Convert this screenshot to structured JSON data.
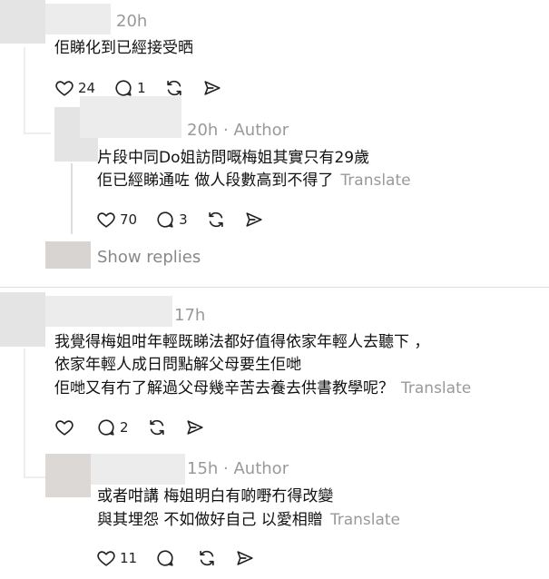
{
  "posts": [
    {
      "time": "20h",
      "author_tag": "",
      "lines": [
        "佢睇化到已經接受晒"
      ],
      "translate": "",
      "likes": "24",
      "replies": "1"
    },
    {
      "time": "20h",
      "author_tag": "· Author",
      "lines": [
        "片段中同Do姐訪問嘅梅姐其實只有29歲",
        "佢已經睇通咗 做人段數高到不得了"
      ],
      "translate": "Translate",
      "likes": "70",
      "replies": "3"
    },
    {
      "time": "17h",
      "author_tag": "",
      "lines": [
        "我覺得梅姐咁年輕既睇法都好值得依家年輕人去聽下 ，",
        "依家年輕人成日問點解父母要生佢哋",
        "佢哋又有冇了解過父母幾辛苦去養去供書教學呢？"
      ],
      "translate": "Translate",
      "likes": "",
      "replies": "2"
    },
    {
      "time": "15h",
      "author_tag": "· Author",
      "lines": [
        "或者咁講 梅姐明白有啲嘢冇得改變",
        "與其埋怨 不如做好自己 以愛相贈"
      ],
      "translate": "Translate",
      "likes": "11",
      "replies": ""
    }
  ],
  "show_replies": "Show replies",
  "icons": [
    "heart-icon",
    "comment-icon",
    "repost-icon",
    "share-icon"
  ]
}
